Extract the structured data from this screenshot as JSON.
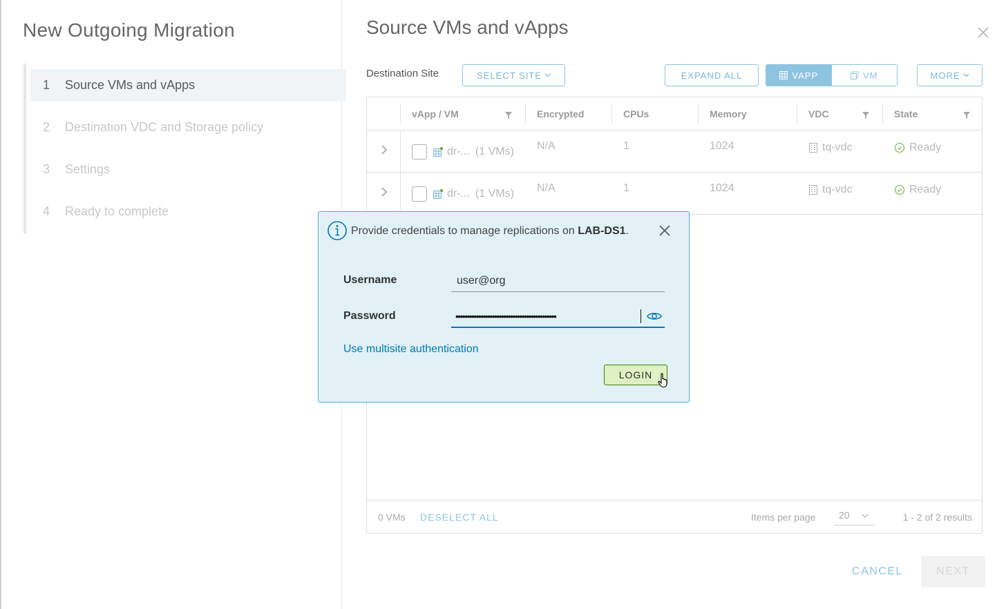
{
  "wizard": {
    "title": "New Outgoing Migration",
    "steps": [
      {
        "num": "1",
        "label": "Source VMs and vApps"
      },
      {
        "num": "2",
        "label": "Destination VDC and Storage policy"
      },
      {
        "num": "3",
        "label": "Settings"
      },
      {
        "num": "4",
        "label": "Ready to complete"
      }
    ],
    "active_step": 1
  },
  "main": {
    "title": "Source VMs and vApps",
    "destination_label": "Destination Site",
    "select_site_label": "SELECT SITE",
    "expand_all_label": "EXPAND ALL",
    "view_toggle": {
      "vapp": "VAPP",
      "vm": "VM",
      "selected": "VAPP"
    },
    "more_label": "MORE"
  },
  "table": {
    "columns": [
      "vApp / VM",
      "Encrypted",
      "CPUs",
      "Memory",
      "VDC",
      "State"
    ],
    "rows": [
      {
        "name": "dr-...",
        "count": "(1 VMs)",
        "encrypted": "N/A",
        "cpus": "1",
        "memory": "1024",
        "vdc": "tq-vdc",
        "state": "Ready"
      },
      {
        "name": "dr-...",
        "count": "(1 VMs)",
        "encrypted": "N/A",
        "cpus": "1",
        "memory": "1024",
        "vdc": "tq-vdc",
        "state": "Ready"
      }
    ],
    "footer": {
      "selected": "0 VMs",
      "deselect_label": "DESELECT ALL",
      "items_per_page_label": "Items per page",
      "items_per_page": "20",
      "results": "1 - 2 of 2 results"
    }
  },
  "actions": {
    "cancel": "CANCEL",
    "next": "NEXT"
  },
  "credentials": {
    "message": "Provide credentials to manage replications on ",
    "site": "LAB-DS1",
    "message_end": ".",
    "username_label": "Username",
    "username_value": "user@org",
    "password_label": "Password",
    "password_mask": "••••••••••••••••••••••••••••••••••••••••••••",
    "multisite_link": "Use multisite authentication",
    "login_label": "LOGIN"
  },
  "colors": {
    "accent": "#0079b8",
    "popover_bg": "#e1f1f6",
    "success": "#2f8400",
    "login_bg": "#dff0c2"
  }
}
